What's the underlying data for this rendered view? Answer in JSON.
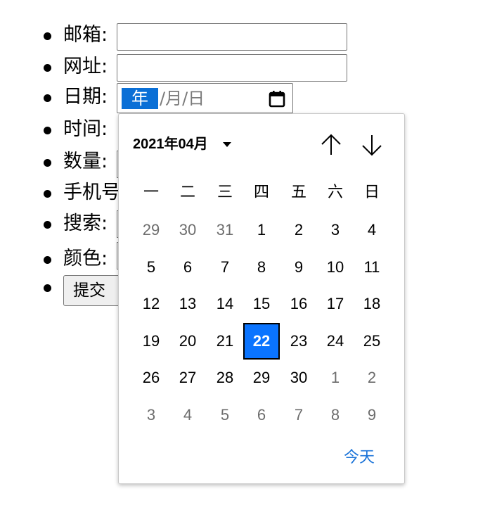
{
  "form": {
    "fields": [
      {
        "label": "邮箱:",
        "type": "email"
      },
      {
        "label": "网址:",
        "type": "url"
      },
      {
        "label": "日期:",
        "type": "date"
      },
      {
        "label": "时间:",
        "type": "time"
      },
      {
        "label": "数量:",
        "type": "number"
      },
      {
        "label": "手机号",
        "type": "tel"
      },
      {
        "label": "搜索:",
        "type": "search"
      },
      {
        "label": "颜色:",
        "type": "color"
      }
    ],
    "submit_label": "提交"
  },
  "date_input": {
    "year_placeholder": "年",
    "rest_placeholder": "/月/日",
    "icon": "calendar-icon"
  },
  "picker": {
    "month_label": "2021年04月",
    "weekdays": [
      "一",
      "二",
      "三",
      "四",
      "五",
      "六",
      "日"
    ],
    "weeks": [
      [
        "29",
        "30",
        "31",
        "1",
        "2",
        "3",
        "4"
      ],
      [
        "5",
        "6",
        "7",
        "8",
        "9",
        "10",
        "11"
      ],
      [
        "12",
        "13",
        "14",
        "15",
        "16",
        "17",
        "18"
      ],
      [
        "19",
        "20",
        "21",
        "22",
        "23",
        "24",
        "25"
      ],
      [
        "26",
        "27",
        "28",
        "29",
        "30",
        "1",
        "2"
      ],
      [
        "3",
        "4",
        "5",
        "6",
        "7",
        "8",
        "9"
      ]
    ],
    "other_month_cells": [
      [
        0,
        0
      ],
      [
        0,
        1
      ],
      [
        0,
        2
      ],
      [
        4,
        5
      ],
      [
        4,
        6
      ],
      [
        5,
        0
      ],
      [
        5,
        1
      ],
      [
        5,
        2
      ],
      [
        5,
        3
      ],
      [
        5,
        4
      ],
      [
        5,
        5
      ],
      [
        5,
        6
      ]
    ],
    "selected_cell": [
      3,
      3
    ],
    "today_label": "今天",
    "prev_icon": "arrow-up-icon",
    "next_icon": "arrow-down-icon",
    "accent_color": "#0a74ff"
  }
}
